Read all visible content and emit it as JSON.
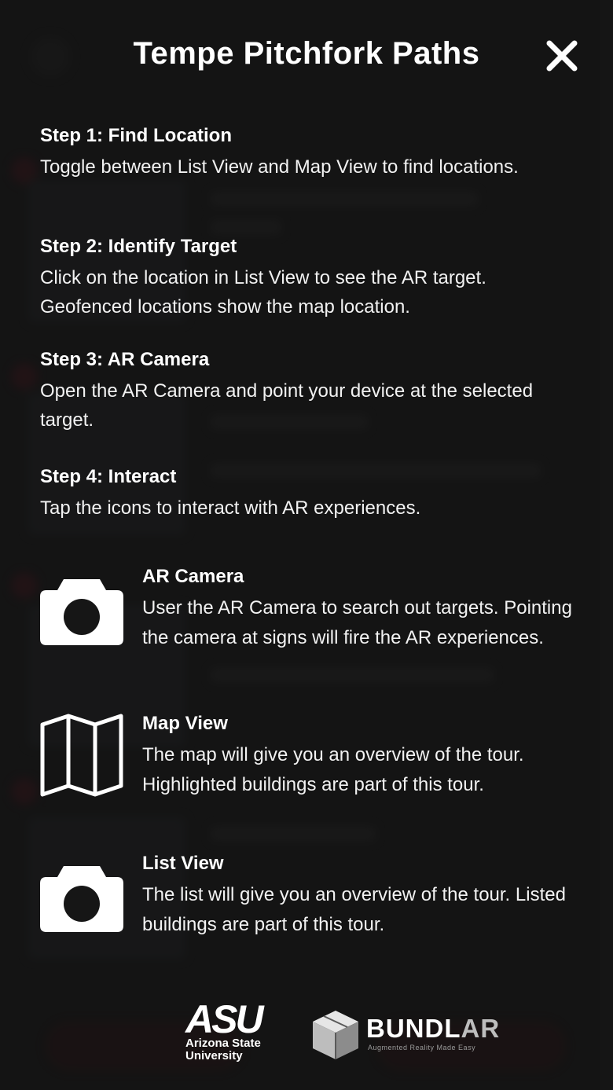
{
  "header": {
    "title": "Tempe Pitchfork Paths"
  },
  "steps": [
    {
      "title": "Step 1: Find Location",
      "body": "Toggle between List View and Map View to find locations."
    },
    {
      "title": "Step 2: Identify Target",
      "body": "Click on the location in List View to see the AR target. Geofenced locations show the map location."
    },
    {
      "title": "Step 3: AR Camera",
      "body": "Open the AR Camera and point your device at the selected target."
    },
    {
      "title": "Step 4: Interact",
      "body": "Tap the icons to interact with AR experiences."
    }
  ],
  "features": [
    {
      "icon": "camera-icon",
      "title": "AR Camera",
      "body": "User the AR Camera to search out targets. Pointing the camera at signs will fire the AR experiences."
    },
    {
      "icon": "map-icon",
      "title": "Map View",
      "body": "The map will give you an overview of the tour. Highlighted buildings are part of this tour."
    },
    {
      "icon": "camera-icon",
      "title": "List View",
      "body": "The list will give you an overview of the tour. Listed buildings are part of this tour."
    }
  ],
  "footer": {
    "asu_mark": "ASU",
    "asu_name_line1": "Arizona State",
    "asu_name_line2": "University",
    "bundlar_word_a": "BUNDL",
    "bundlar_word_b": "AR",
    "bundlar_tagline": "Augmented Reality Made Easy"
  },
  "colors": {
    "background": "#161616",
    "text": "#ffffff",
    "accent_maroon": "#6b1420"
  }
}
